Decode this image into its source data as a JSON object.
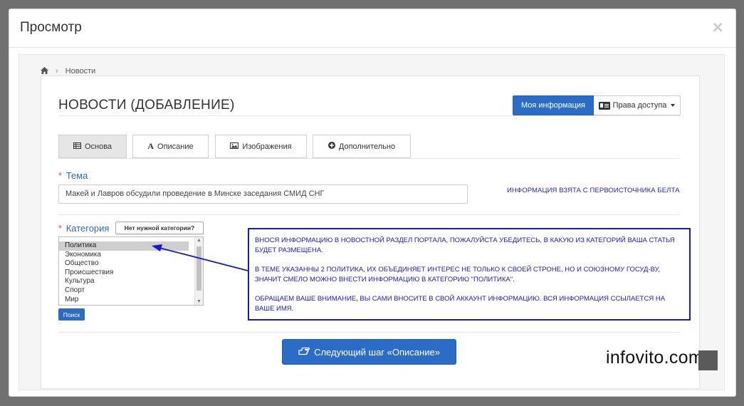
{
  "modal": {
    "title": "Просмотр",
    "close_glyph": "×"
  },
  "breadcrumb": {
    "home_icon": "home-icon",
    "separator": "›",
    "current": "Новости"
  },
  "page": {
    "title": "НОВОСТИ (ДОБАВЛЕНИЕ)",
    "btn_myinfo": "Моя информация",
    "btn_access": "Права доступа"
  },
  "tabs": [
    {
      "label": "Основа",
      "icon": "table-icon",
      "active": true
    },
    {
      "label": "Описание",
      "icon": "font-icon",
      "active": false
    },
    {
      "label": "Изображения",
      "icon": "image-icon",
      "active": false
    },
    {
      "label": "Дополнительно",
      "icon": "plus-circle-icon",
      "active": false
    }
  ],
  "theme": {
    "label": "Тема",
    "required_mark": "*",
    "value": "Макей и Лавров обсудили проведение в Минске заседания СМИД СНГ",
    "note": "ИНФОРМАЦИЯ ВЗЯТА С ПЕРВОИСТОЧНИКА БЕЛТА"
  },
  "category": {
    "label": "Категория",
    "required_mark": "*",
    "no_category_button": "Нет нужной категории?",
    "items": [
      "Политика",
      "Экономика",
      "Общество",
      "Происшествия",
      "Культура",
      "Спорт",
      "Мир"
    ],
    "selected": "Политика",
    "search_button": "Поиск"
  },
  "annotation": {
    "paragraphs": [
      "ВНОСЯ ИНФОРМАЦИЮ В НОВОСТНОЙ РАЗДЕЛ ПОРТАЛА, ПОЖАЛУЙСТА УБЕДИТЕСЬ, В КАКУЮ ИЗ КАТЕГОРИЙ  ВАША СТАТЬЯ БУДЕТ РАЗМЕЩЕНА.",
      "В ТЕМЕ УКАЗАННЫ 2 ПОЛИТИКА, ИХ ОБЪЕДИНЯЕТ ИНТЕРЕС НЕ ТОЛЬКО К СВОЕЙ СТРОНЕ, НО И СОЮЗНОМУ ГОСУД-ВУ, ЗНАЧИТ СМЕЛО МОЖНО ВНЕСТИ ИНФОРМАЦИЮ В КАТЕГОРИЮ \"ПОЛИТИКА\".",
      "ОБРАЩАЕМ ВАШЕ ВНИМАНИЕ, ВЫ САМИ ВНОСИТЕ В СВОЙ АККАУНТ ИНФОРМАЦИЮ. ВСЯ ИНФОРМАЦИЯ ССЫЛАЕТСЯ НА ВАШЕ ИМЯ."
    ],
    "color": "#1818c8"
  },
  "footer": {
    "next_button": "Следующий шаг «Описание»",
    "next_icon": "hand-pointer-icon"
  },
  "watermark": "infovito.com",
  "colors": {
    "primary": "#2b6cc6",
    "required": "#d9534f",
    "label": "#2f6ab5"
  }
}
